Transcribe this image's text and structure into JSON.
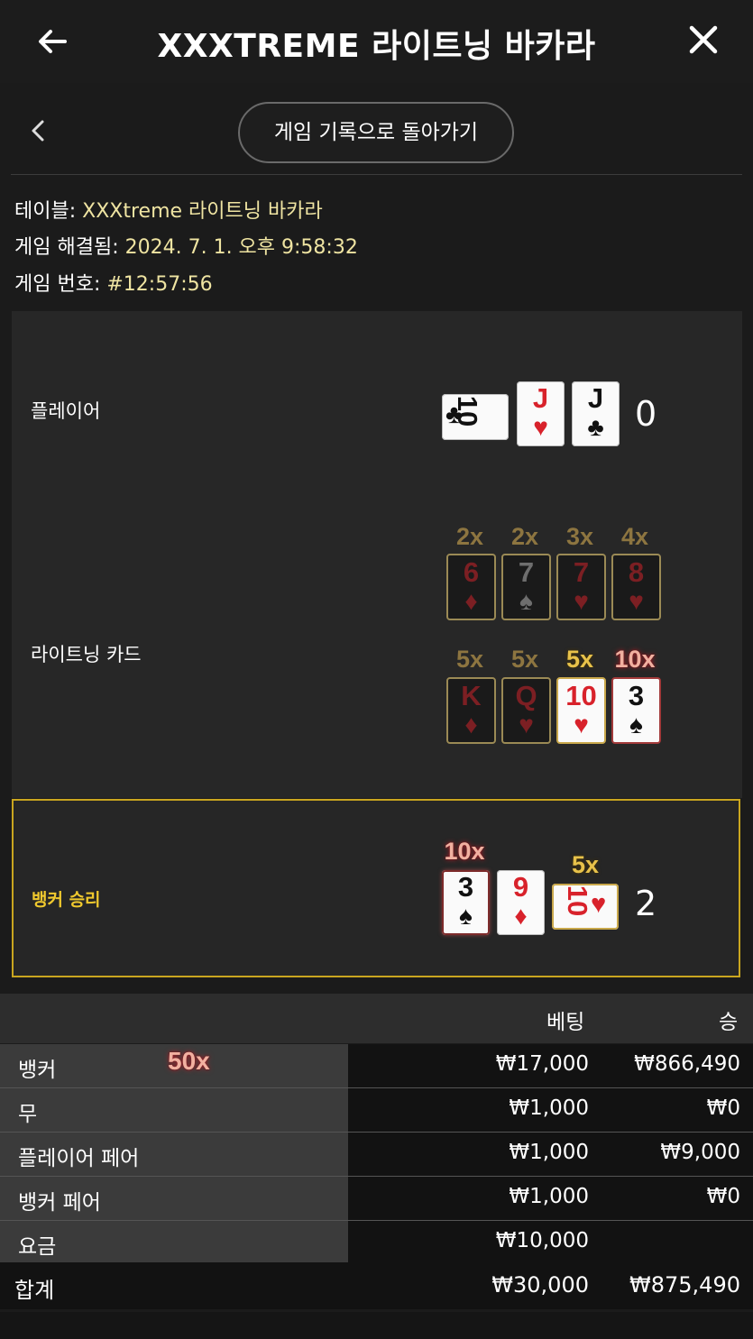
{
  "header": {
    "title": "XXXTREME 라이트닝 바카라",
    "back_icon": "arrow-left-icon",
    "close_icon": "close-icon"
  },
  "nav": {
    "back_history_button": "게임 기록으로 돌아가기"
  },
  "info": {
    "table_label": "테이블: ",
    "table_value": "XXXtreme 라이트닝 바카라",
    "resolved_label": "게임 해결됨: ",
    "resolved_value": "2024. 7. 1. 오후 9:58:32",
    "game_no_label": "게임 번호: ",
    "game_no_value": "#12:57:56"
  },
  "player": {
    "label": "플레이어",
    "score": "0",
    "cards": [
      {
        "rank": "10",
        "suit": "♣",
        "color": "black",
        "orientation": "sideways"
      },
      {
        "rank": "J",
        "suit": "♥",
        "color": "red"
      },
      {
        "rank": "J",
        "suit": "♣",
        "color": "black"
      }
    ]
  },
  "lightning": {
    "label": "라이트닝 카드",
    "cards": [
      {
        "rank": "6",
        "suit": "♦",
        "color": "red",
        "multiplier": "2x",
        "active": false
      },
      {
        "rank": "7",
        "suit": "♠",
        "color": "black",
        "multiplier": "2x",
        "active": false
      },
      {
        "rank": "7",
        "suit": "♥",
        "color": "red",
        "multiplier": "3x",
        "active": false
      },
      {
        "rank": "8",
        "suit": "♥",
        "color": "red",
        "multiplier": "4x",
        "active": false
      },
      {
        "rank": "K",
        "suit": "♦",
        "color": "red",
        "multiplier": "5x",
        "active": false
      },
      {
        "rank": "Q",
        "suit": "♥",
        "color": "red",
        "multiplier": "5x",
        "active": false
      },
      {
        "rank": "10",
        "suit": "♥",
        "color": "red",
        "multiplier": "5x",
        "active": true
      },
      {
        "rank": "3",
        "suit": "♠",
        "color": "black",
        "multiplier": "10x",
        "active": true
      }
    ]
  },
  "banker": {
    "label": "뱅커 승리",
    "score": "2",
    "cards": [
      {
        "rank": "3",
        "suit": "♠",
        "color": "black",
        "multiplier": "10x"
      },
      {
        "rank": "9",
        "suit": "♦",
        "color": "red",
        "multiplier": ""
      },
      {
        "rank": "10",
        "suit": "♥",
        "color": "red",
        "orientation": "sideways",
        "multiplier": "5x"
      }
    ],
    "highlight_color": "#c9a51f"
  },
  "bets_table": {
    "headers": {
      "bet": "베팅",
      "win": "승"
    },
    "rows": [
      {
        "name": "뱅커",
        "badge": "50x",
        "bet": "₩17,000",
        "win": "₩866,490"
      },
      {
        "name": "무",
        "bet": "₩1,000",
        "win": "₩0"
      },
      {
        "name": "플레이어 페어",
        "bet": "₩1,000",
        "win": "₩9,000"
      },
      {
        "name": "뱅커 페어",
        "bet": "₩1,000",
        "win": "₩0"
      },
      {
        "name": "요금",
        "bet": "₩10,000",
        "win": ""
      }
    ],
    "total": {
      "name": "합계",
      "bet": "₩30,000",
      "win": "₩875,490"
    }
  }
}
